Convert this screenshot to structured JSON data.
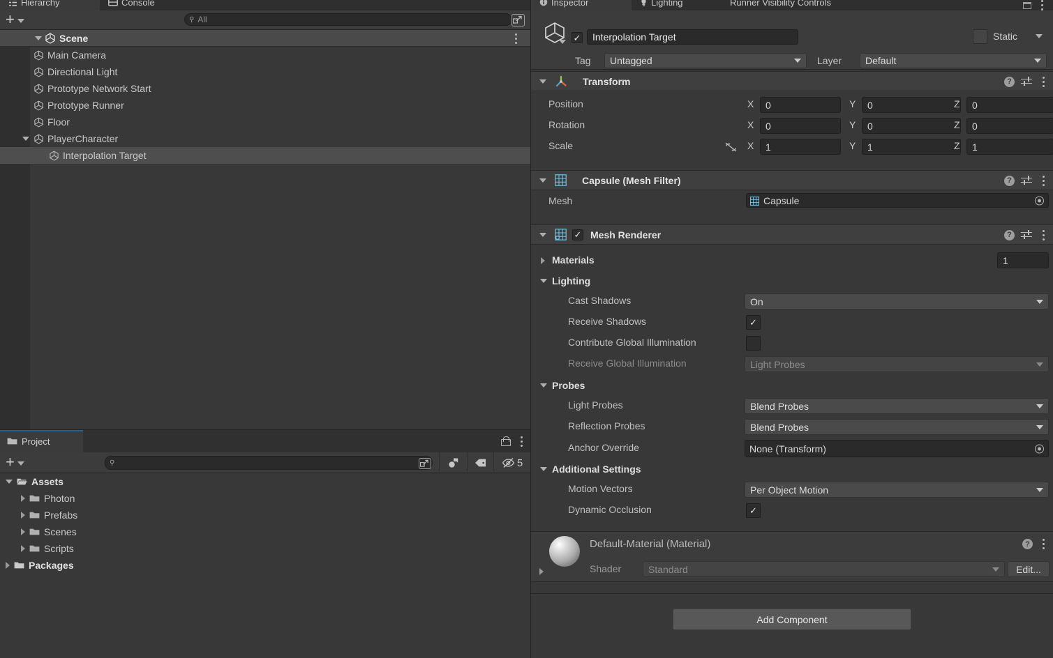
{
  "hierarchy": {
    "tabs": [
      {
        "label": "Hierarchy",
        "icon": "hierarchy-icon",
        "active": true
      },
      {
        "label": "Console",
        "icon": "console-icon",
        "active": false
      }
    ],
    "create_button_label": "+",
    "search": {
      "value": "",
      "placeholder": "All"
    },
    "scene_row": {
      "label": "Scene",
      "icon": "unity-scene-icon"
    },
    "items": [
      {
        "label": "Main Camera",
        "depth": 1,
        "expandable": false,
        "selected": false
      },
      {
        "label": "Directional Light",
        "depth": 1,
        "expandable": false,
        "selected": false
      },
      {
        "label": "Prototype Network Start",
        "depth": 1,
        "expandable": false,
        "selected": false
      },
      {
        "label": "Prototype Runner",
        "depth": 1,
        "expandable": false,
        "selected": false
      },
      {
        "label": "Floor",
        "depth": 1,
        "expandable": false,
        "selected": false
      },
      {
        "label": "PlayerCharacter",
        "depth": 1,
        "expandable": true,
        "selected": false
      },
      {
        "label": "Interpolation Target",
        "depth": 2,
        "expandable": false,
        "selected": true
      }
    ]
  },
  "project": {
    "tab": {
      "label": "Project",
      "icon": "folder-icon"
    },
    "create_button_label": "+",
    "search": {
      "value": "",
      "placeholder": ""
    },
    "hidden_count": "5",
    "items": [
      {
        "label": "Assets",
        "depth": 0,
        "expanded": true,
        "bold": true
      },
      {
        "label": "Photon",
        "depth": 1,
        "expanded": false,
        "bold": false
      },
      {
        "label": "Prefabs",
        "depth": 1,
        "expanded": false,
        "bold": false
      },
      {
        "label": "Scenes",
        "depth": 1,
        "expanded": false,
        "bold": false
      },
      {
        "label": "Scripts",
        "depth": 1,
        "expanded": false,
        "bold": false
      },
      {
        "label": "Packages",
        "depth": 0,
        "expanded": false,
        "bold": true
      }
    ]
  },
  "inspector": {
    "tabs": [
      {
        "label": "Inspector",
        "icon": "inspector-icon",
        "active": true
      },
      {
        "label": "Lighting",
        "icon": "lighting-icon",
        "active": false
      },
      {
        "label": "Runner Visibility Controls",
        "icon": "none",
        "active": false
      }
    ],
    "object": {
      "enabled": true,
      "name": "Interpolation Target",
      "static_label": "Static",
      "static_checked": false,
      "tag_label": "Tag",
      "tag_value": "Untagged",
      "layer_label": "Layer",
      "layer_value": "Default"
    },
    "transform": {
      "title": "Transform",
      "rows": [
        {
          "label": "Position",
          "x": "0",
          "y": "0",
          "z": "0"
        },
        {
          "label": "Rotation",
          "x": "0",
          "y": "0",
          "z": "0"
        },
        {
          "label": "Scale",
          "x": "1",
          "y": "1",
          "z": "1"
        }
      ],
      "axis_x": "X",
      "axis_y": "Y",
      "axis_z": "Z"
    },
    "mesh_filter": {
      "title": "Capsule (Mesh Filter)",
      "mesh_label": "Mesh",
      "mesh_value": "Capsule"
    },
    "mesh_renderer": {
      "title": "Mesh Renderer",
      "enabled": true,
      "materials_label": "Materials",
      "materials_count": "1",
      "lighting_label": "Lighting",
      "cast_shadows_label": "Cast Shadows",
      "cast_shadows_value": "On",
      "receive_shadows_label": "Receive Shadows",
      "receive_shadows_checked": true,
      "contribute_gi_label": "Contribute Global Illumination",
      "contribute_gi_checked": false,
      "receive_gi_label": "Receive Global Illumination",
      "receive_gi_value": "Light Probes",
      "probes_label": "Probes",
      "light_probes_label": "Light Probes",
      "light_probes_value": "Blend Probes",
      "reflection_probes_label": "Reflection Probes",
      "reflection_probes_value": "Blend Probes",
      "anchor_override_label": "Anchor Override",
      "anchor_override_value": "None (Transform)",
      "additional_settings_label": "Additional Settings",
      "motion_vectors_label": "Motion Vectors",
      "motion_vectors_value": "Per Object Motion",
      "dynamic_occlusion_label": "Dynamic Occlusion",
      "dynamic_occlusion_checked": true
    },
    "material": {
      "title": "Default-Material (Material)",
      "shader_label": "Shader",
      "shader_value": "Standard",
      "edit_label": "Edit..."
    },
    "add_component_label": "Add Component"
  },
  "colors": {
    "panel_bg": "#383838",
    "header_bg": "#3c3c3c",
    "component_header": "#3f3f3f",
    "selection": "#4e4e4e",
    "scene_row": "#4a4a4a",
    "accent_blue": "#2c5d87",
    "field_bg": "#2a2a2a",
    "dropdown_bg": "#4a4a4a",
    "gutter": "#2f2f2f"
  }
}
